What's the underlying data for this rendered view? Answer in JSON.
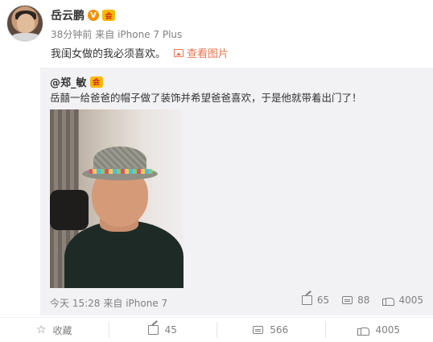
{
  "author": {
    "name": "岳云鹏",
    "v_badge": "V",
    "member_badge": "会",
    "timestamp": "38分钟前",
    "source": "来自 iPhone 7 Plus"
  },
  "post": {
    "text": "我闺女做的我必须喜欢。",
    "view_picture_label": "查看图片"
  },
  "repost": {
    "user": "@郑_敏",
    "member_badge": "会",
    "text": "岳囍一给爸爸的帽子做了装饰并希望爸爸喜欢，于是他就带着出门了！",
    "timestamp": "今天 15:28",
    "source": "来自 iPhone 7",
    "forward_count": "65",
    "comment_count": "88",
    "like_count": "4005"
  },
  "actions": {
    "favorite_label": "收藏",
    "forward_count": "45",
    "comment_count": "566",
    "like_count": "4005"
  },
  "icons": {
    "avatar": "avatar",
    "picture": "picture-icon",
    "forward": "forward-icon",
    "comment": "comment-icon",
    "like": "like-icon",
    "favorite": "star-icon"
  },
  "colors": {
    "accent": "#eb7350",
    "v_badge": "#f29100",
    "repost_bg": "#f2f2f5"
  }
}
